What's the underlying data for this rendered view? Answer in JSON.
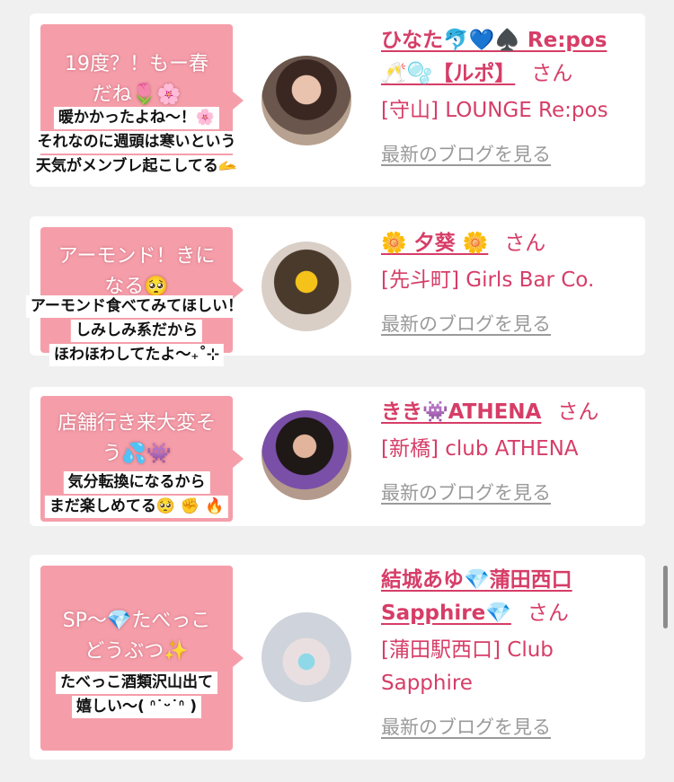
{
  "posts": [
    {
      "headline": "19度？！もー春だね🌷🌸",
      "caption": [
        "暖かかったよね〜！🌸",
        "それなのに週頭は寒いという",
        "天気がメンブレ起こしてる🫴"
      ],
      "name_line1": "ひなた🐬💙♠️ Re:pos",
      "name_line2": "🥂🫧【ルポ】",
      "san": "さん",
      "shop_line1": "[守山] LOUNGE Re:pos",
      "shop_line2": "",
      "blog_link": "最新のブログを見る"
    },
    {
      "headline": "アーモンド！きになる🥺",
      "caption": [
        "アーモンド食べてみてほしい！",
        "しみしみ系だから",
        "ほわほわしてたよ〜₊˚⊹"
      ],
      "name_line1": "🌼 夕葵 🌼",
      "name_line2": "",
      "san": "さん",
      "shop_line1": "[先斗町] Girls Bar Co.",
      "shop_line2": "",
      "blog_link": "最新のブログを見る"
    },
    {
      "headline": "店舗行き来大変そう💦👾",
      "caption": [
        "気分転換になるから",
        "まだ楽しめてる🥺 ✊ 🔥"
      ],
      "name_line1": "きき👾ATHENA",
      "name_line2": "",
      "san": "さん",
      "shop_line1": "[新橋] club ATHENA",
      "shop_line2": "",
      "blog_link": "最新のブログを見る"
    },
    {
      "headline": "SP〜💎たべっこどうぶつ✨",
      "caption": [
        "たべっこ酒類沢山出て",
        "嬉しい〜( ᐢ˙ᵕ˙ᐢ )"
      ],
      "name_line1": "結城あゆ💎蒲田西口",
      "name_line2": "Sapphire💎",
      "san": "さん",
      "shop_line1": "[蒲田駅西口] Club",
      "shop_line2": "Sapphire",
      "blog_link": "最新のブログを見る"
    }
  ],
  "colors": {
    "background": "#f0f0f0",
    "card": "#ffffff",
    "bubble": "#f59eaa",
    "accent": "#d63d67",
    "link_gray": "#9a9a9a"
  }
}
